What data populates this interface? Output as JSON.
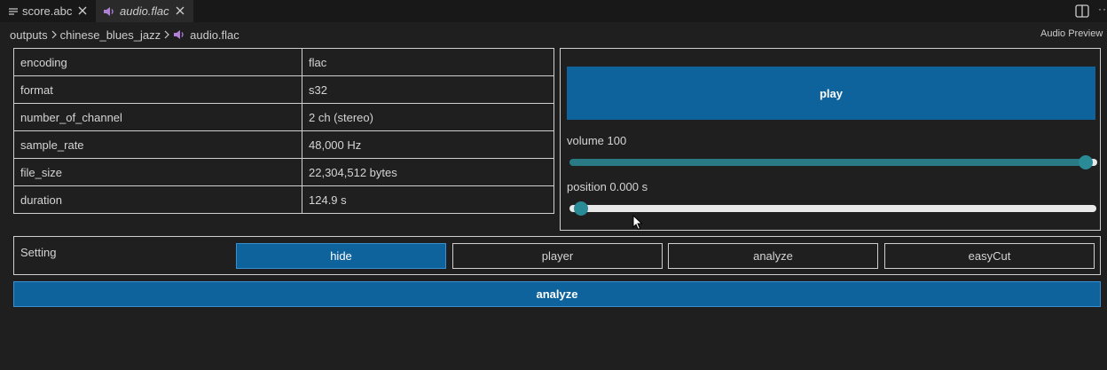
{
  "tabs": [
    {
      "label": "score.abc",
      "icon": "lines-icon"
    },
    {
      "label": "audio.flac",
      "icon": "speaker-icon"
    }
  ],
  "breadcrumb": [
    "outputs",
    "chinese_blues_jazz",
    "audio.flac"
  ],
  "preview_label": "Audio Preview",
  "info": [
    {
      "key": "encoding",
      "value": "flac"
    },
    {
      "key": "format",
      "value": "s32"
    },
    {
      "key": "number_of_channel",
      "value": "2 ch (stereo)"
    },
    {
      "key": "sample_rate",
      "value": "48,000 Hz"
    },
    {
      "key": "file_size",
      "value": "22,304,512 bytes"
    },
    {
      "key": "duration",
      "value": "124.9 s"
    }
  ],
  "player": {
    "play_label": "play",
    "volume_label": "volume 100",
    "volume_level": 1.0,
    "position_label": "position 0.000 s",
    "position_level": 0.0
  },
  "setting": {
    "label": "Setting",
    "buttons": [
      "hide",
      "player",
      "analyze",
      "easyCut"
    ],
    "active": "hide"
  },
  "analyze_label": "analyze",
  "colors": {
    "accent": "#0e639c",
    "slider": "#2a7a86",
    "background": "#1f1f1f"
  }
}
